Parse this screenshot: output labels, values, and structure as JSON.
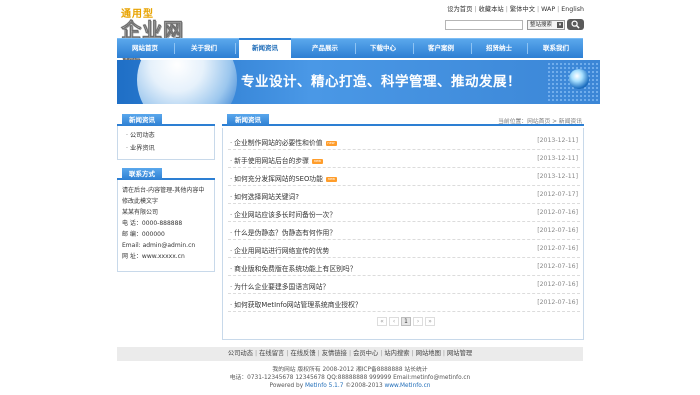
{
  "header": {
    "logo_top": "通用型",
    "logo_main": "企业网站",
    "top_links": [
      "设为首页",
      "收藏本站",
      "繁体中文",
      "WAP",
      "English"
    ],
    "search_select": "整站搜索"
  },
  "nav": [
    "网站首页",
    "关于我们",
    "新闻资讯",
    "产品展示",
    "下载中心",
    "客户案例",
    "招贤纳士",
    "联系我们"
  ],
  "banner": {
    "slogan": "专业设计、精心打造、科学管理、推动发展！"
  },
  "sidebar": {
    "news_title": "新闻资讯",
    "categories": [
      "公司动态",
      "业界资讯"
    ],
    "contact_title": "联系方式",
    "contact_lines": [
      "请在后台-内容管理-其他内容中",
      "修改此模文字",
      "某某有限公司",
      "电 话：0000-888888",
      "邮 编：000000",
      "Email: admin@admin.cn",
      "网 址：www.xxxxx.cn"
    ]
  },
  "main": {
    "tab_title": "新闻资讯",
    "breadcrumb": "当前位置：网站首页 > 新闻资讯",
    "new_badge": "new",
    "news": [
      {
        "title": "企业制作网站的必要性和价值",
        "date": "[2013-12-11]",
        "new": true
      },
      {
        "title": "新手使用网站后台的步骤",
        "date": "[2013-12-11]",
        "new": true
      },
      {
        "title": "如何充分发挥网站的SEO功能",
        "date": "[2013-12-11]",
        "new": true
      },
      {
        "title": "如何选择网站关键词?",
        "date": "[2012-07-17]",
        "new": false
      },
      {
        "title": "企业网站应该多长时间备份一次？",
        "date": "[2012-07-16]",
        "new": false
      },
      {
        "title": "什么是伪静态？伪静态有何作用？",
        "date": "[2012-07-16]",
        "new": false
      },
      {
        "title": "企业用网站进行网络宣传的优势",
        "date": "[2012-07-16]",
        "new": false
      },
      {
        "title": "商业版和免费版在系统功能上有区别吗？",
        "date": "[2012-07-16]",
        "new": false
      },
      {
        "title": "为什么企业要建多国语言网站？",
        "date": "[2012-07-16]",
        "new": false
      },
      {
        "title": "如何获取MetInfo网站管理系统商业授权？",
        "date": "[2012-07-16]",
        "new": false
      }
    ],
    "pager": [
      "«",
      "‹",
      "1",
      "›",
      "»"
    ]
  },
  "footer": {
    "links": [
      "公司动态",
      "在线留言",
      "在线反馈",
      "友情链接",
      "会员中心",
      "站内搜索",
      "网站地图",
      "网站管理"
    ],
    "line1": "我的网站 版权所有 2008-2012 湘ICP备8888888 站长统计",
    "line2": "电话：0731-12345678 12345678 QQ:88888888 999999 Email:metinfo@metinfo.cn",
    "line3_prefix": "Powered by ",
    "line3_link": "MetInfo 5.1.7",
    "line3_mid": " ©2008-2013 ",
    "line3_site": "www.MetInfo.cn"
  }
}
